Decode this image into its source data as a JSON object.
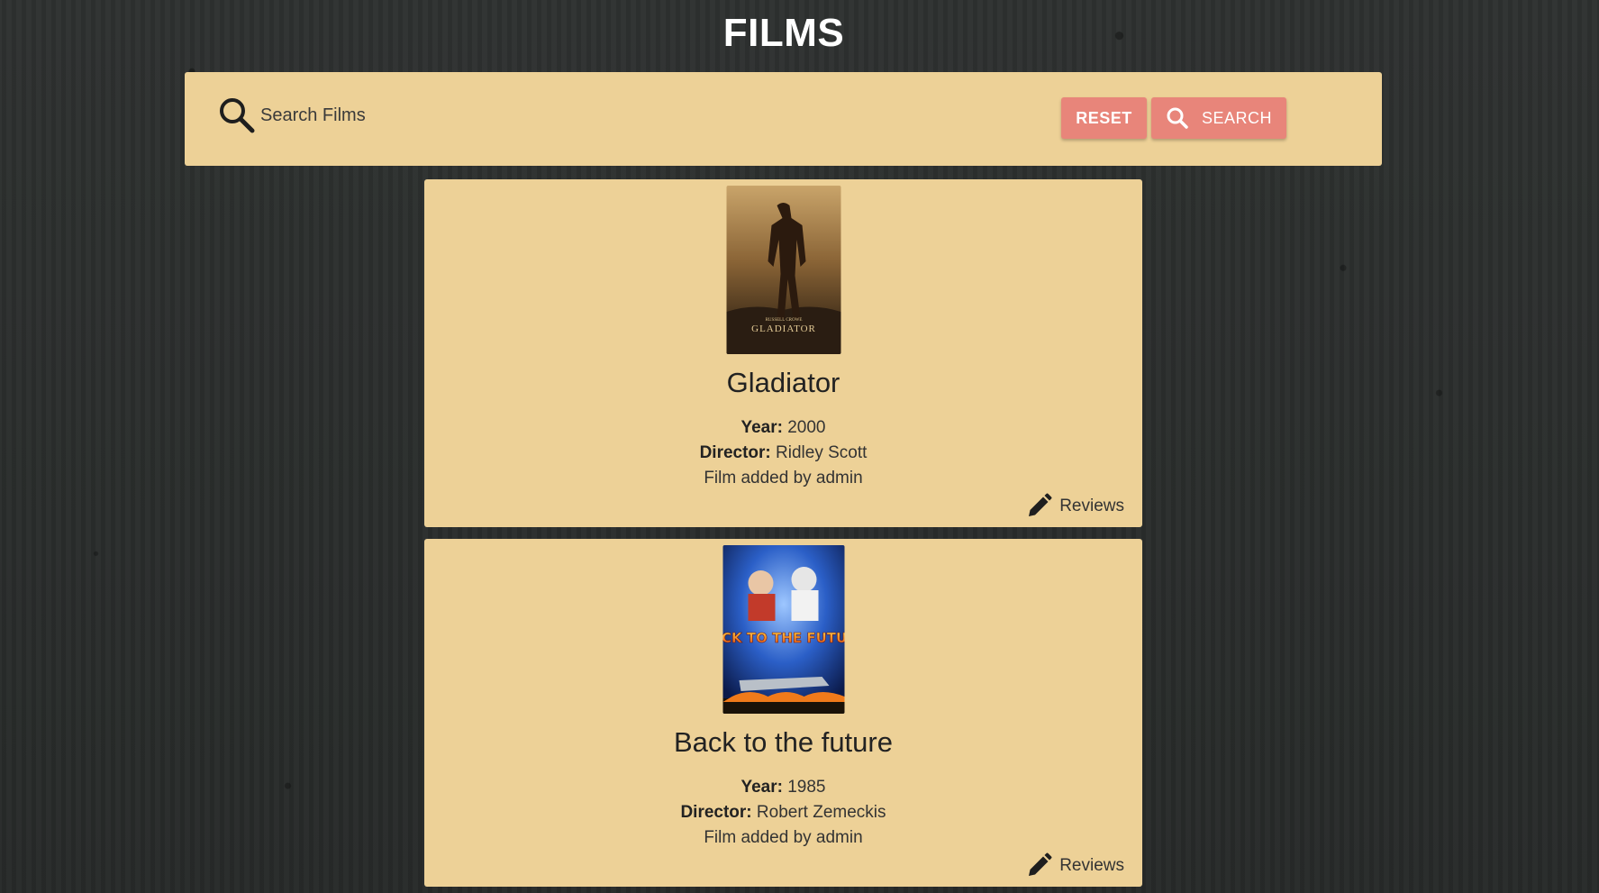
{
  "header": {
    "title": "FILMS"
  },
  "search": {
    "placeholder": "Search Films",
    "value": "",
    "reset_label": "RESET",
    "search_label": "SEARCH",
    "icon": "search-icon"
  },
  "colors": {
    "panel": "#edd197",
    "button": "#e8857a",
    "background": "#2c2f2e"
  },
  "films": [
    {
      "title": "Gladiator",
      "year_label": "Year:",
      "year": "2000",
      "director_label": "Director:",
      "director": "Ridley Scott",
      "added_by": "Film added by admin",
      "reviews_label": "Reviews",
      "poster_text": "GLADIATOR",
      "poster_credit": "RUSSELL CROWE"
    },
    {
      "title": "Back to the future",
      "year_label": "Year:",
      "year": "1985",
      "director_label": "Director:",
      "director": "Robert Zemeckis",
      "added_by": "Film added by admin",
      "reviews_label": "Reviews",
      "poster_text": "BACK TO THE FUTURE"
    }
  ]
}
